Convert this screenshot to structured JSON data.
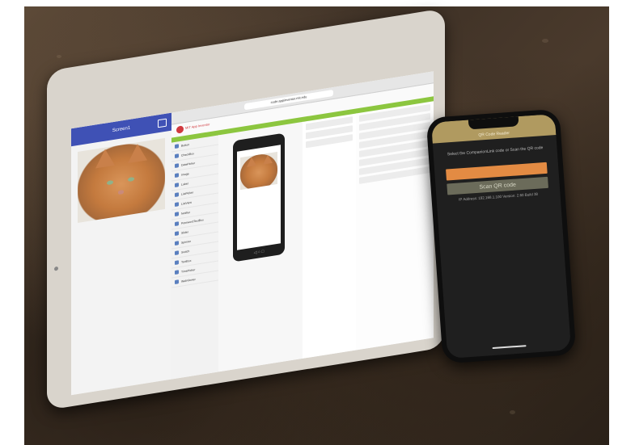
{
  "photo": {
    "description_hidden": ""
  },
  "ipad": {
    "browser": {
      "url": "code.appinventor.mit.edu"
    },
    "logo_text": "MIT App Inventor",
    "left_app": {
      "title": "Screen1"
    },
    "palette_items": [
      "Button",
      "CheckBox",
      "DatePicker",
      "Image",
      "Label",
      "ListPicker",
      "ListView",
      "Notifier",
      "PasswordTextBox",
      "Slider",
      "Spinner",
      "Switch",
      "TextBox",
      "TimePicker",
      "WebViewer"
    ]
  },
  "iphone": {
    "title": "QR Code Reader",
    "instructions": "Select the CompanionLink code or Scan the QR code",
    "button_orange": "",
    "button_scan": "Scan QR code",
    "footer": "IP Address: 192.168.1.100 Version: 2.60 Build 38"
  },
  "colors": {
    "appinventor_green": "#8cc63f",
    "app_bar_blue": "#3f51b5",
    "phone_orange": "#e38b43",
    "phone_title_gold": "#b09a60"
  }
}
